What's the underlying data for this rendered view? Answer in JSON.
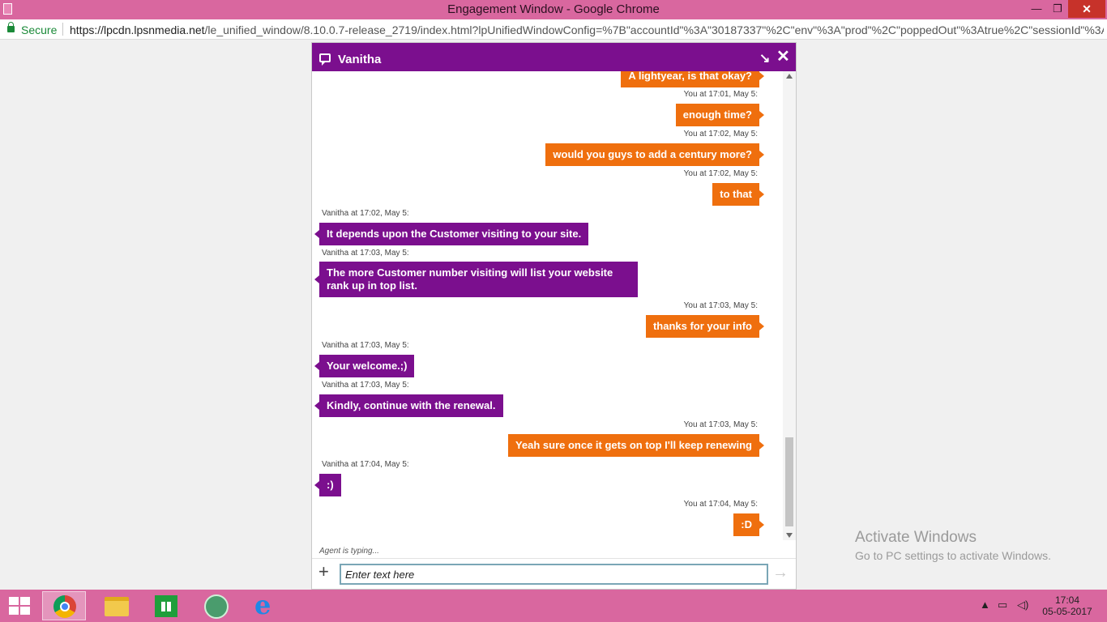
{
  "browser": {
    "title": "Engagement Window - Google Chrome",
    "secure_label": "Secure",
    "url_host": "https://lpcdn.lpsnmedia.net",
    "url_path": "/le_unified_window/8.10.0.7-release_2719/index.html?lpUnifiedWindowConfig=%7B\"accountId\"%3A\"30187337\"%2C\"env\"%3A\"prod\"%2C\"poppedOut\"%3Atrue%2C\"sessionId\"%3A\"",
    "controls": {
      "minimize": "—",
      "restore": "❐",
      "close": "✕"
    }
  },
  "chat": {
    "agent_name": "Vanitha",
    "typing_status": "Agent is typing...",
    "input_placeholder": "Enter text here",
    "messages": [
      {
        "sender": "you",
        "text": "A lightyear, is that okay?"
      },
      {
        "sender": "you",
        "stamp": "You at 17:01, May 5:",
        "text": "enough time?"
      },
      {
        "sender": "you",
        "stamp": "You at 17:02, May 5:",
        "text": "would you guys to add a century more?"
      },
      {
        "sender": "you",
        "stamp": "You at 17:02, May 5:",
        "text": "to that"
      },
      {
        "sender": "agent",
        "stamp": "Vanitha at 17:02, May 5:",
        "text": "It depends upon the Customer visiting to your site."
      },
      {
        "sender": "agent",
        "stamp": "Vanitha at 17:03, May 5:",
        "text": "The more Customer number visiting will list your website rank up in top list."
      },
      {
        "sender": "you",
        "stamp": "You at 17:03, May 5:",
        "text": "thanks for your info"
      },
      {
        "sender": "agent",
        "stamp": "Vanitha at 17:03, May 5:",
        "text": "Your welcome.;)"
      },
      {
        "sender": "agent",
        "stamp": "Vanitha at 17:03, May 5:",
        "text": "Kindly, continue with the renewal."
      },
      {
        "sender": "you",
        "stamp": "You at 17:03, May 5:",
        "text": "Yeah sure once it gets on top I'll keep renewing"
      },
      {
        "sender": "agent",
        "stamp": "Vanitha at 17:04, May 5:",
        "text": ":)"
      },
      {
        "sender": "you",
        "stamp": "You at 17:04, May 5:",
        "text": ":D"
      }
    ]
  },
  "watermark": {
    "line1": "Activate Windows",
    "line2": "Go to PC settings to activate Windows."
  },
  "taskbar": {
    "time": "17:04",
    "date": "05-05-2017",
    "tray_icons": [
      "chevron-up-icon",
      "network-icon",
      "volume-icon"
    ],
    "apps": [
      "chrome-icon",
      "file-explorer-icon",
      "store-icon",
      "atom-icon",
      "internet-explorer-icon"
    ]
  }
}
